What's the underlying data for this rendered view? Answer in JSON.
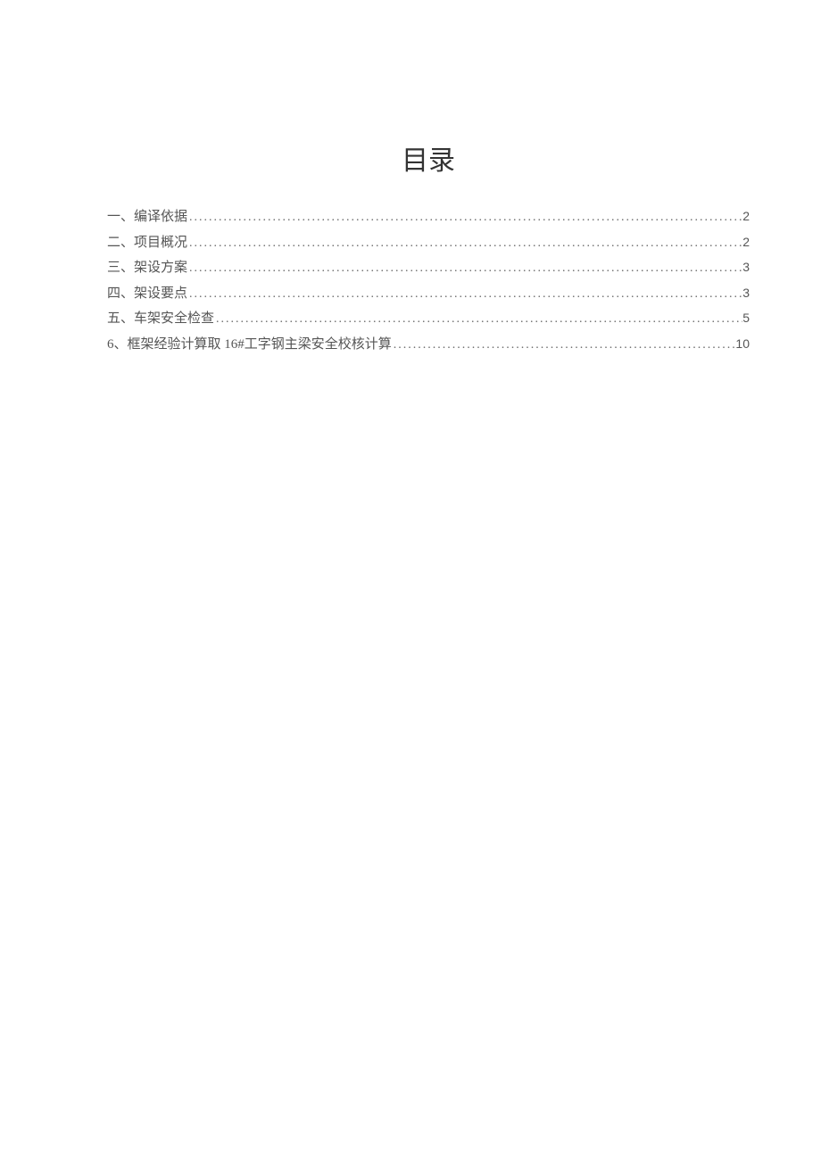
{
  "title": "目录",
  "toc": [
    {
      "label": "一、编译依据",
      "page": "2"
    },
    {
      "label": "二、项目概况",
      "page": "2"
    },
    {
      "label": "三、架设方案",
      "page": "3"
    },
    {
      "label": "四、架设要点",
      "page": "3"
    },
    {
      "label": "五、车架安全检查",
      "page": "5"
    },
    {
      "label": "6、框架经验计算取 16#工字钢主梁安全校核计算",
      "page": "10"
    }
  ]
}
